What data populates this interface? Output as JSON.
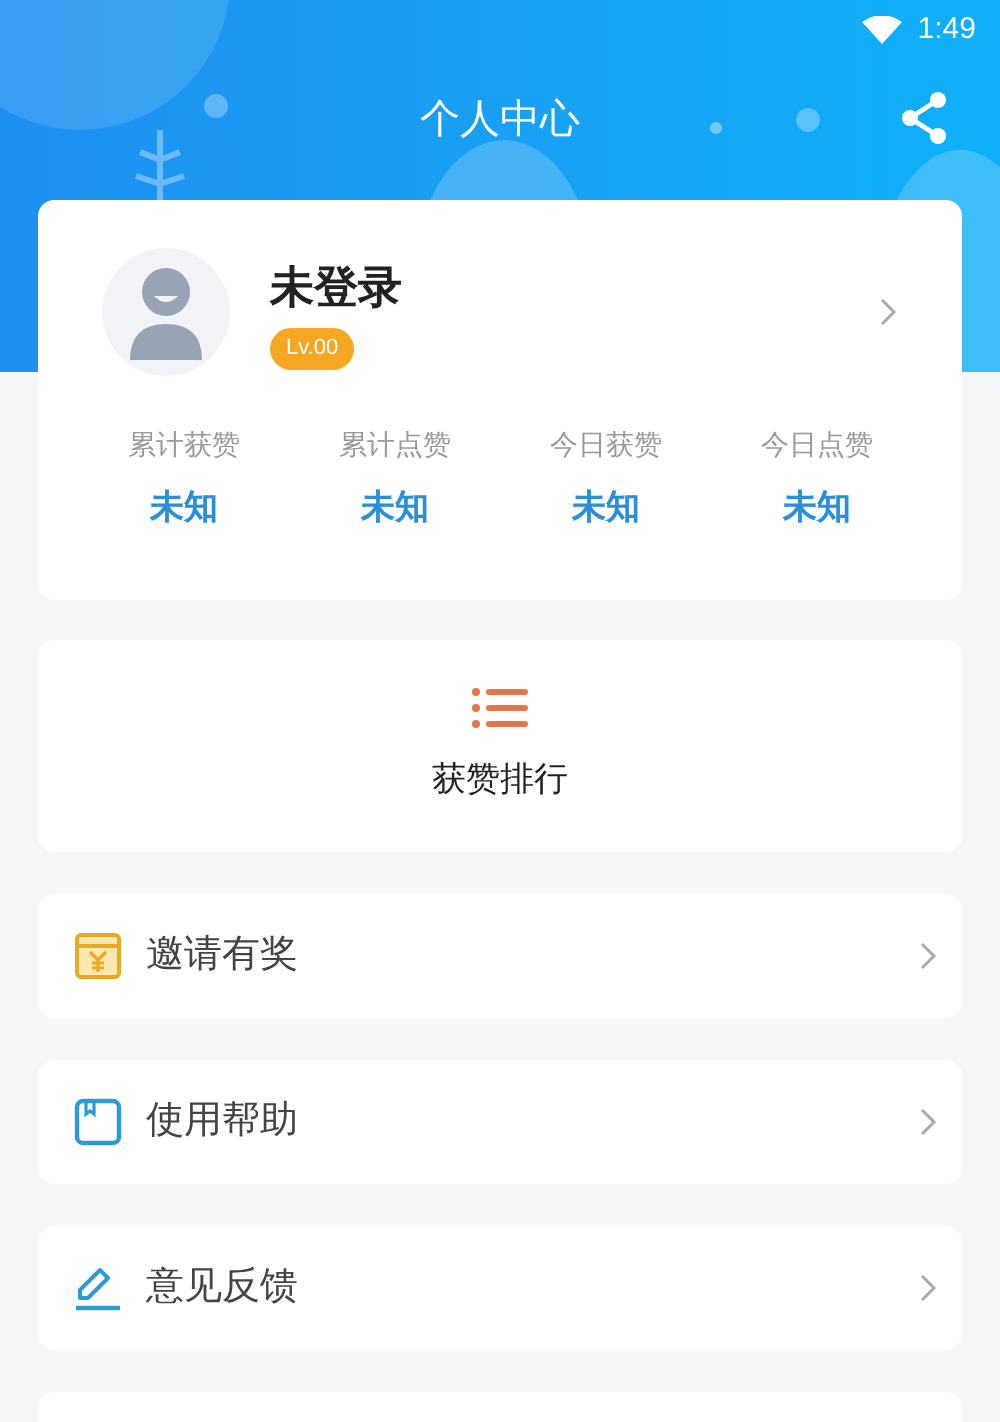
{
  "status_bar": {
    "time": "1:49"
  },
  "header": {
    "title": "个人中心"
  },
  "profile": {
    "name": "未登录",
    "level_badge": "Lv.00",
    "stats": [
      {
        "label": "累计获赞",
        "value": "未知"
      },
      {
        "label": "累计点赞",
        "value": "未知"
      },
      {
        "label": "今日获赞",
        "value": "未知"
      },
      {
        "label": "今日点赞",
        "value": "未知"
      }
    ]
  },
  "ranking": {
    "label": "获赞排行"
  },
  "menu": [
    {
      "kind": "invite",
      "label": "邀请有奖"
    },
    {
      "kind": "help",
      "label": "使用帮助"
    },
    {
      "kind": "feedback",
      "label": "意见反馈"
    },
    {
      "kind": "partial"
    }
  ]
}
